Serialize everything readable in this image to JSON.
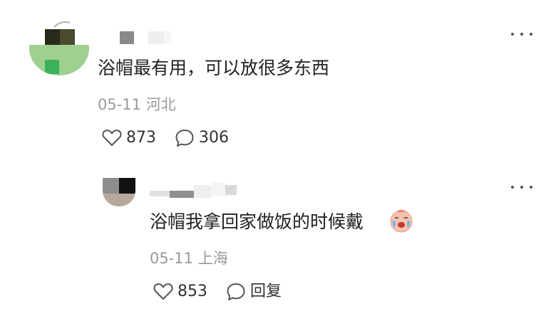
{
  "top_comment": {
    "text": "浴帽最有用，可以放很多东西",
    "date": "05-11",
    "location": "河北",
    "likes": "873",
    "replies": "306",
    "avatar_icon": "pixelated-avatar",
    "more_icon": "more-icon"
  },
  "reply": {
    "text": "浴帽我拿回家做饭的时候戴",
    "emoji": "crying-face-emoji",
    "date": "05-11",
    "location": "上海",
    "likes": "853",
    "reply_label": "回复",
    "avatar_icon": "pixelated-avatar",
    "more_icon": "more-icon"
  },
  "colors": {
    "text": "#222222",
    "meta": "#9a9a9a",
    "icon": "#555555"
  }
}
